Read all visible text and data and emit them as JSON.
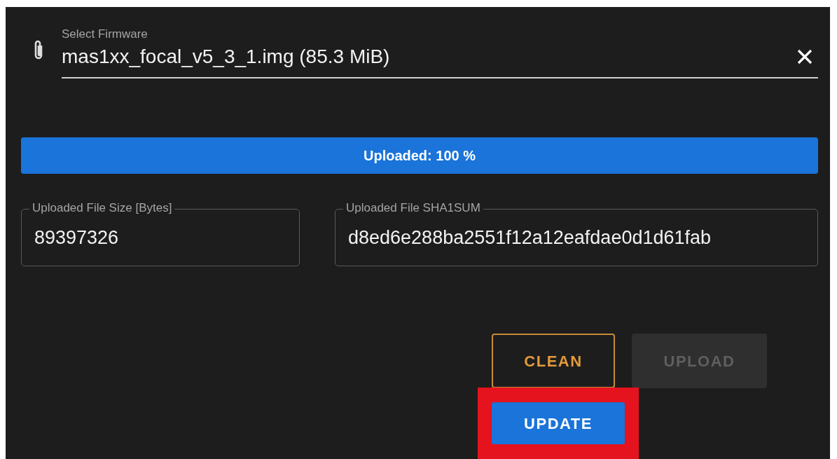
{
  "firmware_field": {
    "label": "Select Firmware",
    "value": "mas1xx_focal_v5_3_1.img (85.3 MiB)"
  },
  "progress": {
    "label": "Uploaded: 100 %",
    "level": 1
  },
  "info_fields": [
    {
      "label": "Uploaded File Size [Bytes]",
      "value": "89397326"
    },
    {
      "label": "Uploaded File SHA1SUM",
      "value": "d8ed6e288ba2551f12a12eafdae0d1d61fab"
    }
  ],
  "buttons": [
    {
      "label": "CLEAN",
      "kind": "outlined",
      "disabled": false
    },
    {
      "label": "UPLOAD",
      "kind": "contained",
      "disabled": true
    }
  ],
  "update_button": {
    "label": "UPDATE",
    "highlighted": true
  }
}
